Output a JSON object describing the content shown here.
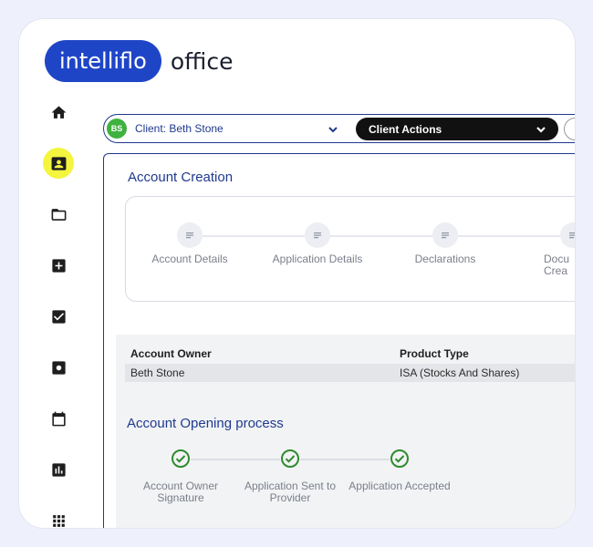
{
  "brand": {
    "pill_text": "intelliflo",
    "word": "office"
  },
  "sidebar": {
    "items": [
      {
        "icon": "home-icon",
        "active": false
      },
      {
        "icon": "contact-card-icon",
        "active": true
      },
      {
        "icon": "folder-icon",
        "active": false
      },
      {
        "icon": "add-box-icon",
        "active": false
      },
      {
        "icon": "checkbox-icon",
        "active": false
      },
      {
        "icon": "settings-box-icon",
        "active": false
      },
      {
        "icon": "calendar-icon",
        "active": false
      },
      {
        "icon": "bar-chart-icon",
        "active": false
      },
      {
        "icon": "apps-grid-icon",
        "active": false
      }
    ]
  },
  "client_bar": {
    "initials": "BS",
    "client_label": "Client: Beth Stone",
    "actions_label": "Client Actions"
  },
  "account_creation": {
    "title": "Account Creation",
    "steps": [
      {
        "label": "Account Details"
      },
      {
        "label": "Application Details"
      },
      {
        "label": "Declarations"
      },
      {
        "label": "Docu Crea"
      }
    ]
  },
  "account_table": {
    "headers": [
      "Account Owner",
      "Product Type"
    ],
    "row": [
      "Beth Stone",
      "ISA (Stocks And Shares)"
    ]
  },
  "opening_process": {
    "title": "Account Opening process",
    "steps": [
      {
        "label": "Account Owner Signature",
        "done": true
      },
      {
        "label": "Application Sent to Provider",
        "done": true
      },
      {
        "label": "Application Accepted",
        "done": true
      }
    ]
  },
  "colors": {
    "brand_blue": "#1f45c7",
    "navy": "#1f3a8f",
    "active_highlight": "#f3f53e",
    "success_green": "#2e8b2e",
    "avatar_green": "#3fb13f"
  }
}
